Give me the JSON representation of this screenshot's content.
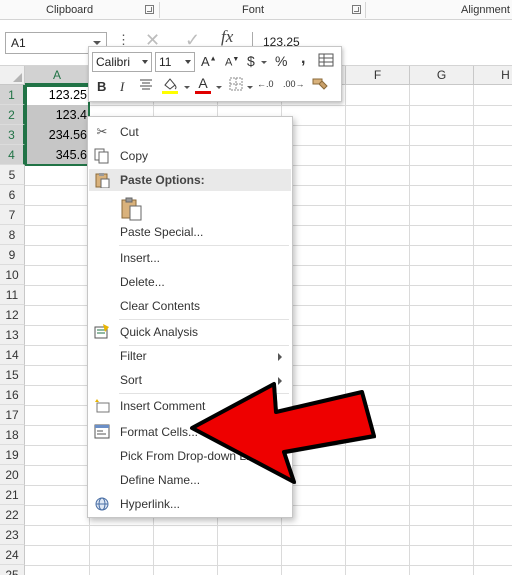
{
  "ribbon": {
    "groups": [
      {
        "label": "Clipboard"
      },
      {
        "label": "Font"
      },
      {
        "label": "Alignment"
      }
    ]
  },
  "formula_bar": {
    "name_box": "A1",
    "formula": "123.25",
    "icons": [
      "more-icon",
      "cancel-icon",
      "enter-icon",
      "fx-icon"
    ],
    "fx_label": "fx",
    "dots": "⋮"
  },
  "grid": {
    "columns": [
      "A",
      "B",
      "C",
      "D",
      "E",
      "F",
      "G",
      "H"
    ],
    "rows": [
      "1",
      "2",
      "3",
      "4",
      "5",
      "6",
      "7",
      "8",
      "9",
      "10",
      "11",
      "12",
      "13",
      "14",
      "15",
      "16",
      "17",
      "18",
      "19",
      "20",
      "21",
      "22",
      "23",
      "24",
      "25"
    ],
    "cells": [
      "123.25",
      "123.4",
      "234.56",
      "345.6"
    ]
  },
  "mini_toolbar": {
    "font_name": "Calibri",
    "font_size": "11",
    "grow_font": "A",
    "shrink_font": "A",
    "currency": "$",
    "percent": "%",
    "comma": ",",
    "bold": "B",
    "italic": "I",
    "font_color_letter": "A",
    "fill_color": "#ffff00",
    "font_color": "#e00000",
    "increase_decimal": "←.0",
    "decrease_decimal": ".00→"
  },
  "context_menu": {
    "items": [
      {
        "label": "Cut",
        "icon": "scissors-icon"
      },
      {
        "label": "Copy",
        "icon": "copy-icon"
      },
      {
        "label": "Paste Options:",
        "icon": "paste-icon"
      },
      {
        "label": "Paste Special...",
        "icon": ""
      },
      {
        "label": "Insert...",
        "icon": ""
      },
      {
        "label": "Delete...",
        "icon": ""
      },
      {
        "label": "Clear Contents",
        "icon": ""
      },
      {
        "label": "Quick Analysis",
        "icon": "quick-analysis-icon"
      },
      {
        "label": "Filter",
        "icon": ""
      },
      {
        "label": "Sort",
        "icon": ""
      },
      {
        "label": "Insert Comment",
        "icon": "comment-icon"
      },
      {
        "label": "Format Cells...",
        "icon": "format-cells-icon"
      },
      {
        "label": "Pick From Drop-down List...",
        "icon": ""
      },
      {
        "label": "Define Name...",
        "icon": ""
      },
      {
        "label": "Hyperlink...",
        "icon": "hyperlink-icon"
      }
    ]
  },
  "colors": {
    "excel_green": "#217346",
    "selection_gray": "#c6c6c6",
    "arrow_red": "#ee0000"
  }
}
